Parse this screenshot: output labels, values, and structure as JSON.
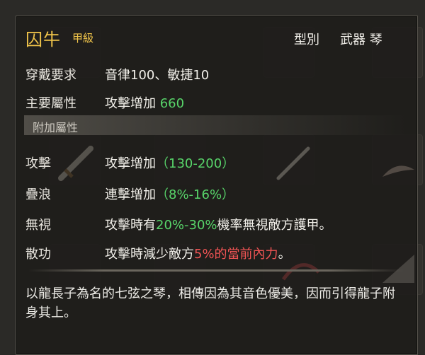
{
  "item": {
    "name": "囚牛",
    "grade": "甲級",
    "type_label": "型別",
    "type_value": "武器 琴",
    "requirement_label": "穿戴要求",
    "requirement_value": "音律100、敏捷10",
    "main_attr_label": "主要屬性",
    "main_attr_text": "攻擊增加",
    "main_attr_value": "660",
    "extra_section_title": "附加屬性",
    "extra_attrs": [
      {
        "label": "攻擊",
        "text": "攻擊增加",
        "value": "（130-200）"
      },
      {
        "label": "疊浪",
        "text": "連擊增加",
        "value": "（8%-16%）"
      },
      {
        "label": "無視",
        "prefix": "攻擊時有",
        "value": "20%-30%",
        "suffix": "機率無視敵方護甲。"
      },
      {
        "label": "散功",
        "prefix": "攻擊時減少敵方",
        "value": "5%的當前內力",
        "suffix": "。"
      }
    ],
    "description": "以龍長子為名的七弦之琴，相傳因為其音色優美，因而引得龍子附身其上。"
  },
  "colors": {
    "title": "#f0c44a",
    "green": "#58d56a",
    "red": "#f05454"
  }
}
